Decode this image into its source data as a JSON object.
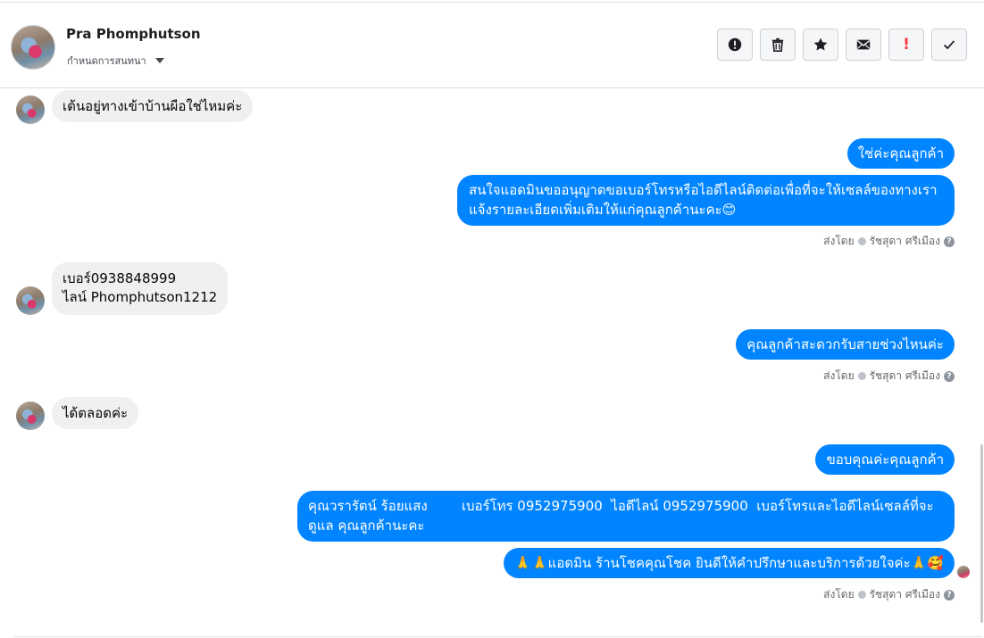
{
  "header": {
    "contact_name": "Pra Phomphutson",
    "assign_label": "กำหนดการสนทนา",
    "toolbar": [
      {
        "name": "spam-report-button",
        "icon": "exclamation-circle-icon"
      },
      {
        "name": "delete-button",
        "icon": "trash-icon"
      },
      {
        "name": "star-button",
        "icon": "star-icon"
      },
      {
        "name": "mark-unread-button",
        "icon": "envelope-icon"
      },
      {
        "name": "follow-up-button",
        "icon": "red-exclamation-icon"
      },
      {
        "name": "mark-done-button",
        "icon": "checkmark-icon"
      }
    ]
  },
  "messages": {
    "m1": "เต้นอยู่ทางเข้าบ้านผือใช่ไหมค่ะ",
    "m2": "ใช่ค่ะคุณลูกค้า",
    "m3": "สนใจแอดมินขออนุญาตขอเบอร์โทรหรือไอดีไลน์ติดต่อเพื่อที่จะให้เซลล์ของทางเรา แจ้งรายละเอียดเพิ่มเติมให้แก่คุณลูกค้านะคะ😊",
    "m4_line1": "เบอร์0938848999",
    "m4_line2": "ไลน์ Phomphutson1212",
    "m5": "คุณลูกค้าสะดวกรับสายช่วงไหนค่ะ",
    "m6": "ได้ตลอดค่ะ",
    "m7": "ขอบคุณค่ะคุณลูกค้า",
    "m8": "คุณวรารัตน์ ร้อยแสง        เบอร์โทร 0952975900  ไอดีไลน์ 0952975900  เบอร์โทรและไอดีไลน์เซลล์ที่จะดูแล คุณลูกค้านะคะ",
    "m9": "🙏🙏แอดมิน ร้านโชคคุณโชค ยินดีให้คำปรึกษาและบริการด้วยใจค่ะ🙏🥰"
  },
  "sent_by": {
    "prefix": "ส่งโดย",
    "agent": "รัชสุดา ศรีเมือง"
  },
  "colors": {
    "outgoing_bubble": "#0084ff",
    "incoming_bubble": "#f0f0f0",
    "follow_up_accent": "#fa383e"
  }
}
